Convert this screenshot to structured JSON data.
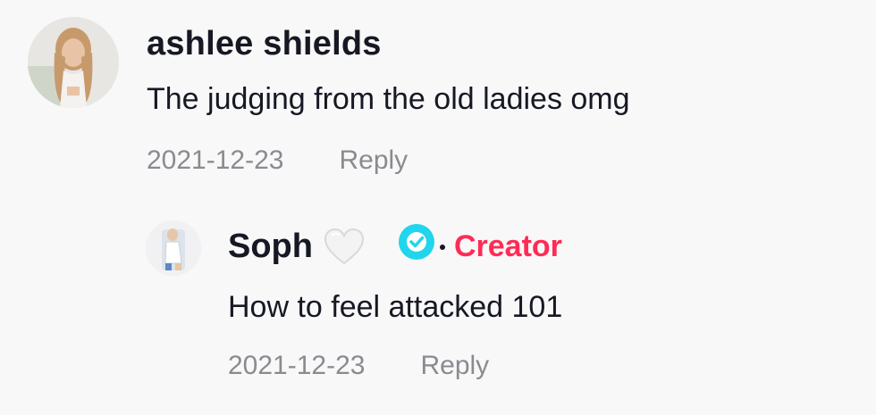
{
  "comments": [
    {
      "username": "ashlee shields",
      "text": "The judging from the old ladies omg",
      "date": "2021-12-23",
      "reply_label": "Reply"
    }
  ],
  "reply": {
    "username": "Soph",
    "emoji": "white-heart",
    "badge_icon": "verified-badge-icon",
    "badge_label": "Creator",
    "text": "How to feel attacked 101",
    "date": "2021-12-23",
    "reply_label": "Reply"
  },
  "colors": {
    "creator_accent": "#fe2c55",
    "verified": "#20d5ec",
    "meta_text": "#8a8b91"
  }
}
